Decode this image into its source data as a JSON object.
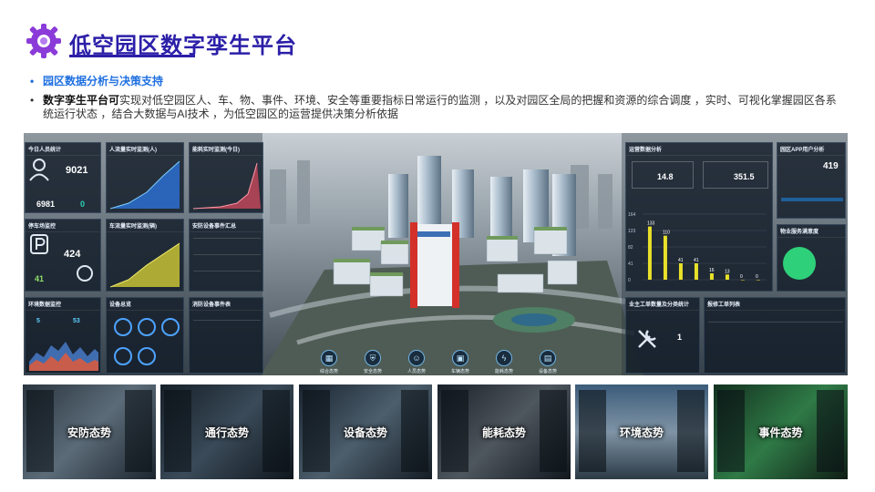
{
  "header": {
    "title": "低空园区数字孪生平台"
  },
  "bullets": {
    "heading": "园区数据分析与决策支持",
    "desc_strong": "数字孪生平台可",
    "desc_rest": "实现对低空园区人、车、物、事件、环境、安全等重要指标日常运行的监测 ，以及对园区全局的把握和资源的综合调度 ，实时、可视化掌握园区各系统运行状态 ，结合大数据与AI技术 ，为低空园区的运营提供决策分析依据"
  },
  "dashboard": {
    "panels": {
      "today_people": {
        "title": "今日人员统计",
        "value": "9021",
        "value2": "6981",
        "value3": "0"
      },
      "people_flow": {
        "title": "人流量实时监测(人)"
      },
      "energy": {
        "title": "能耗实时监测(今日)"
      },
      "parking": {
        "title": "停车场监控",
        "value": "424",
        "value2": "41"
      },
      "vehicle_flow": {
        "title": "车流量实时监测(辆)"
      },
      "alarm": {
        "title": "安防设备事件汇总"
      },
      "env": {
        "title": "环境数据监控",
        "temp": "5",
        "humidity": "53"
      },
      "devices": {
        "title": "设备总览"
      },
      "fire": {
        "title": "消防设备事件表"
      },
      "ops": {
        "title": "运营数据分析",
        "v1": "14.8",
        "v2": "351.5"
      },
      "app_users": {
        "title": "园区APP用户分析",
        "value": "419"
      },
      "property": {
        "title": "物业服务满意度"
      },
      "workorder": {
        "title": "业主工单数量及分类统计",
        "value": "1"
      },
      "report": {
        "title": "报修工单列表"
      }
    },
    "ops_chart": {
      "y_ticks": [
        "164",
        "123",
        "82",
        "41",
        "0"
      ],
      "bar_values": [
        "133",
        "110",
        "41",
        "41",
        "16",
        "13",
        "0",
        "0"
      ]
    },
    "nav": [
      {
        "label": "综合态势",
        "icon": "grid-icon"
      },
      {
        "label": "安全态势",
        "icon": "shield-icon"
      },
      {
        "label": "人员态势",
        "icon": "person-icon"
      },
      {
        "label": "车辆态势",
        "icon": "car-icon"
      },
      {
        "label": "能耗态势",
        "icon": "bolt-icon"
      },
      {
        "label": "设备态势",
        "icon": "device-icon"
      }
    ]
  },
  "thumbnails": [
    {
      "label": "安防态势"
    },
    {
      "label": "通行态势"
    },
    {
      "label": "设备态势"
    },
    {
      "label": "能耗态势"
    },
    {
      "label": "环境态势"
    },
    {
      "label": "事件态势"
    }
  ],
  "colors": {
    "title": "#2c1fa8",
    "accent_blue": "#1e6fe0",
    "logo": "#8a3bd8",
    "bar_yellow": "#e8e02a",
    "donut_green": "#2fd07a"
  }
}
